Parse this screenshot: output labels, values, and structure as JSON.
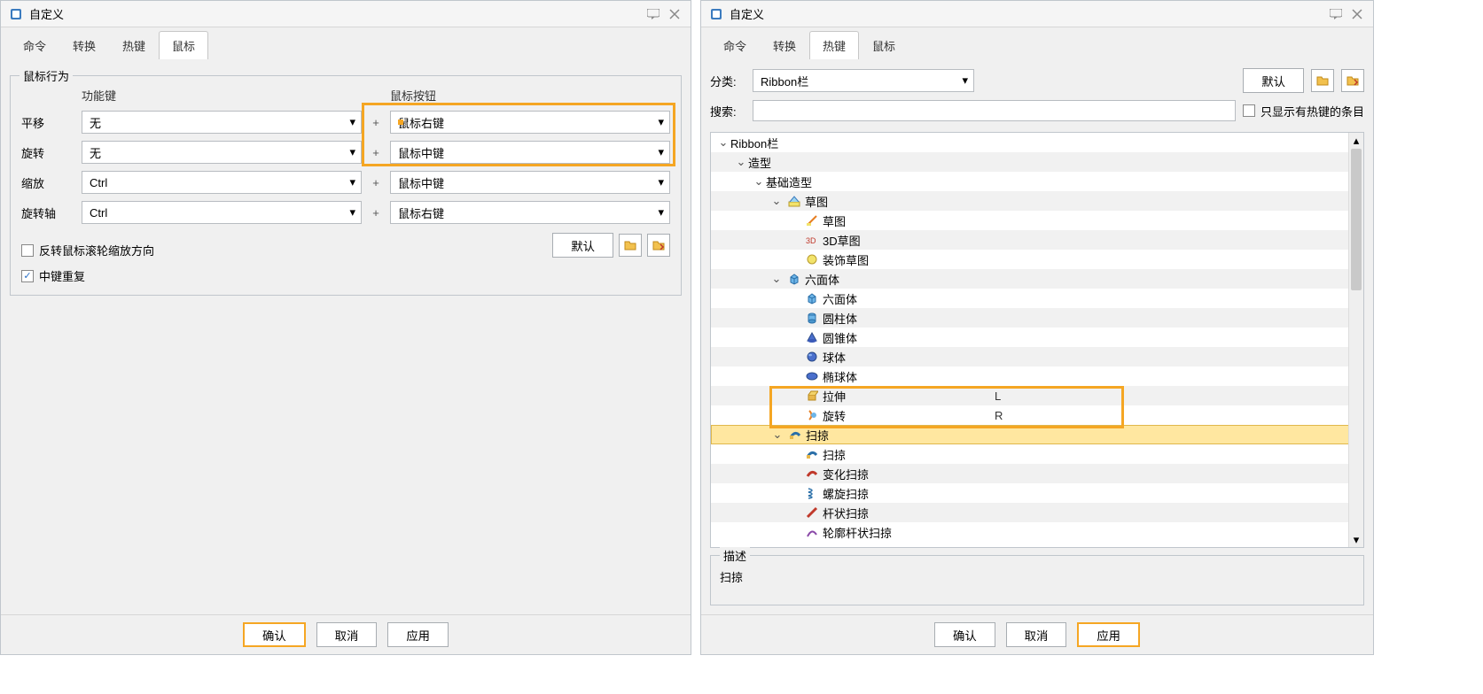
{
  "left": {
    "title": "自定义",
    "tabs": [
      "命令",
      "转换",
      "热键",
      "鼠标"
    ],
    "active_tab": 3,
    "group_legend": "鼠标行为",
    "header_func": "功能键",
    "header_btn": "鼠标按钮",
    "rows": [
      {
        "label": "平移",
        "func": "无",
        "btn": "鼠标右键"
      },
      {
        "label": "旋转",
        "func": "无",
        "btn": "鼠标中键"
      },
      {
        "label": "缩放",
        "func": "Ctrl",
        "btn": "鼠标中键"
      },
      {
        "label": "旋转轴",
        "func": "Ctrl",
        "btn": "鼠标右键"
      }
    ],
    "chk_reverse": "反转鼠标滚轮缩放方向",
    "chk_middle_repeat": "中键重复",
    "btn_default": "默认",
    "buttons": {
      "ok": "确认",
      "cancel": "取消",
      "apply": "应用"
    }
  },
  "right": {
    "title": "自定义",
    "tabs": [
      "命令",
      "转换",
      "热键",
      "鼠标"
    ],
    "active_tab": 2,
    "label_category": "分类:",
    "category_value": "Ribbon栏",
    "btn_default": "默认",
    "label_search": "搜索:",
    "search_value": "",
    "chk_only_hotkey": "只显示有热键的条目",
    "tree": [
      {
        "ind": 0,
        "exp": "open",
        "label": "Ribbon栏",
        "icon": null,
        "hotkey": "",
        "alt": false
      },
      {
        "ind": 1,
        "exp": "open",
        "label": "造型",
        "icon": null,
        "hotkey": "",
        "alt": true
      },
      {
        "ind": 2,
        "exp": "open",
        "label": "基础造型",
        "icon": null,
        "hotkey": "",
        "alt": false
      },
      {
        "ind": 3,
        "exp": "open",
        "label": "草图",
        "icon": "sketch",
        "hotkey": "",
        "alt": true
      },
      {
        "ind": 4,
        "exp": "",
        "label": "草图",
        "icon": "sketch2",
        "hotkey": "",
        "alt": false
      },
      {
        "ind": 4,
        "exp": "",
        "label": "3D草图",
        "icon": "sketch3d",
        "hotkey": "",
        "alt": true
      },
      {
        "ind": 4,
        "exp": "",
        "label": "装饰草图",
        "icon": "deco",
        "hotkey": "",
        "alt": false
      },
      {
        "ind": 3,
        "exp": "open",
        "label": "六面体",
        "icon": "cube",
        "hotkey": "",
        "alt": true
      },
      {
        "ind": 4,
        "exp": "",
        "label": "六面体",
        "icon": "cube",
        "hotkey": "",
        "alt": false
      },
      {
        "ind": 4,
        "exp": "",
        "label": "圆柱体",
        "icon": "cylinder",
        "hotkey": "",
        "alt": true
      },
      {
        "ind": 4,
        "exp": "",
        "label": "圆锥体",
        "icon": "cone",
        "hotkey": "",
        "alt": false
      },
      {
        "ind": 4,
        "exp": "",
        "label": "球体",
        "icon": "sphere",
        "hotkey": "",
        "alt": true
      },
      {
        "ind": 4,
        "exp": "",
        "label": "椭球体",
        "icon": "ellipsoid",
        "hotkey": "",
        "alt": false
      },
      {
        "ind": 4,
        "exp": "",
        "label": "拉伸",
        "icon": "extrude",
        "hotkey": "L",
        "alt": true
      },
      {
        "ind": 4,
        "exp": "",
        "label": "旋转",
        "icon": "revolve",
        "hotkey": "R",
        "alt": false
      },
      {
        "ind": 3,
        "exp": "open",
        "label": "扫掠",
        "icon": "sweep",
        "hotkey": "",
        "alt": true,
        "sel": true
      },
      {
        "ind": 4,
        "exp": "",
        "label": "扫掠",
        "icon": "sweep",
        "hotkey": "",
        "alt": false
      },
      {
        "ind": 4,
        "exp": "",
        "label": "变化扫掠",
        "icon": "varsweep",
        "hotkey": "",
        "alt": true
      },
      {
        "ind": 4,
        "exp": "",
        "label": "螺旋扫掠",
        "icon": "helix",
        "hotkey": "",
        "alt": false
      },
      {
        "ind": 4,
        "exp": "",
        "label": "杆状扫掠",
        "icon": "rod",
        "hotkey": "",
        "alt": true
      },
      {
        "ind": 4,
        "exp": "",
        "label": "轮廓杆状扫掠",
        "icon": "profrod",
        "hotkey": "",
        "alt": false
      }
    ],
    "desc_legend": "描述",
    "desc_text": "扫掠",
    "buttons": {
      "ok": "确认",
      "cancel": "取消",
      "apply": "应用"
    }
  }
}
